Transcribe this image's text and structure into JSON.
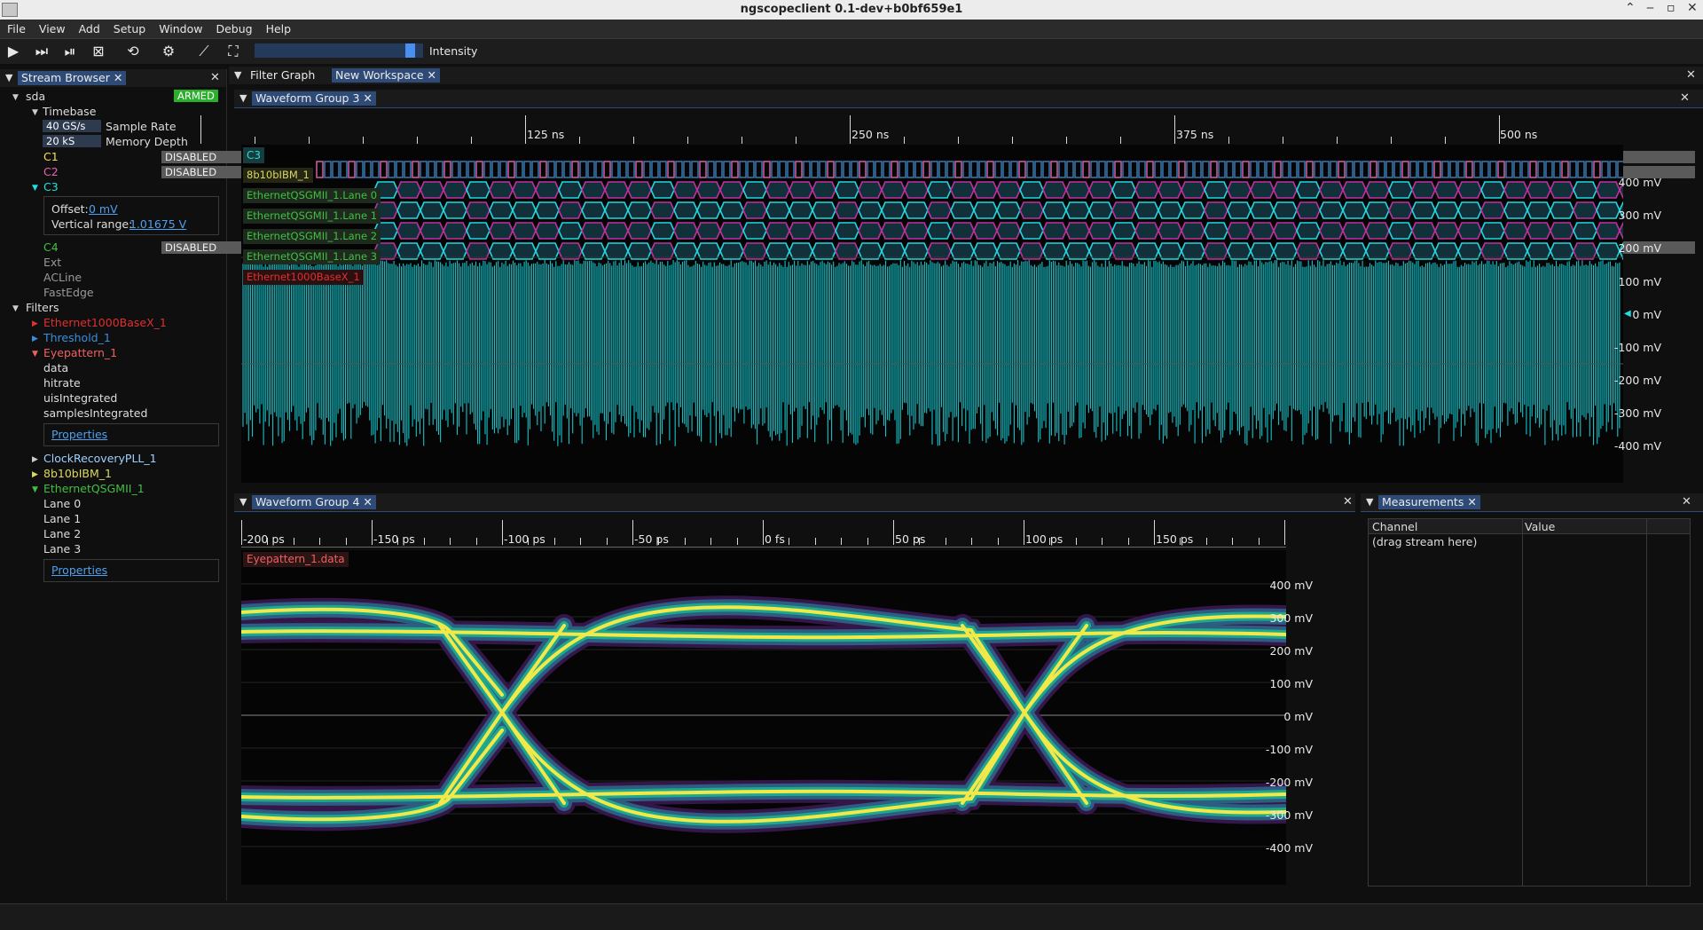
{
  "window": {
    "title": "ngscopeclient 0.1-dev+b0bf659e1"
  },
  "menu": [
    "File",
    "View",
    "Add",
    "Setup",
    "Window",
    "Debug",
    "Help"
  ],
  "toolbar": {
    "intensity_label": "Intensity",
    "intensity_level": 0.95
  },
  "stream_browser": {
    "tab": "Stream Browser",
    "instrument": "sda",
    "status": "ARMED",
    "timebase": {
      "label": "Timebase",
      "sample_rate": "40 GS/s",
      "sample_rate_label": "Sample Rate",
      "memory_depth": "20 kS",
      "memory_depth_label": "Memory Depth"
    },
    "channels": {
      "c1": {
        "name": "C1",
        "state": "DISABLED"
      },
      "c2": {
        "name": "C2",
        "state": "DISABLED"
      },
      "c3": {
        "name": "C3",
        "offset_label": "Offset:",
        "offset": "0 mV",
        "range_label": "Vertical range:",
        "range": "1.01675 V"
      },
      "c4": {
        "name": "C4",
        "state": "DISABLED"
      },
      "others": [
        "Ext",
        "ACLine",
        "FastEdge"
      ]
    },
    "filters_label": "Filters",
    "filters": {
      "eth1000": "Ethernet1000BaseX_1",
      "threshold": "Threshold_1",
      "eyepattern": "Eyepattern_1",
      "eye_streams": [
        "data",
        "hitrate",
        "uisIntegrated",
        "samplesIntegrated"
      ],
      "properties": "Properties",
      "cdr": "ClockRecoveryPLL_1",
      "ibm": "8b10bIBM_1",
      "qsgmii": "EthernetQSGMII_1",
      "lanes": [
        "Lane 0",
        "Lane 1",
        "Lane 2",
        "Lane 3"
      ],
      "properties2": "Properties"
    }
  },
  "workspace_tabs": [
    "Filter Graph",
    "New Workspace"
  ],
  "group3": {
    "tab": "Waveform Group 3",
    "time_ticks": [
      "125 ns",
      "250 ns",
      "375 ns",
      "500 ns"
    ],
    "channel": "C3",
    "protocols": [
      "8b10bIBM_1",
      "EthernetQSGMII_1.Lane 0",
      "EthernetQSGMII_1.Lane 1",
      "EthernetQSGMII_1.Lane 2",
      "EthernetQSGMII_1.Lane 3",
      "Ethernet1000BaseX_1"
    ],
    "volts": [
      "400 mV",
      "300 mV",
      "200 mV",
      "100 mV",
      "0 mV",
      "-100 mV",
      "-200 mV",
      "-300 mV",
      "-400 mV"
    ]
  },
  "group4": {
    "tab": "Waveform Group 4",
    "time_ticks": [
      "-200 ps",
      "-150 ps",
      "-100 ps",
      "-50 ps",
      "0 fs",
      "50 ps",
      "100 ps",
      "150 ps"
    ],
    "trace": "Eyepattern_1.data",
    "volts": [
      "400 mV",
      "300 mV",
      "200 mV",
      "100 mV",
      "0 mV",
      "-100 mV",
      "-200 mV",
      "-300 mV",
      "-400 mV"
    ]
  },
  "measurements": {
    "tab": "Measurements",
    "col_channel": "Channel",
    "col_value": "Value",
    "placeholder": "(drag stream here)"
  },
  "colors": {
    "c1": "#f0e050",
    "c2": "#f060b0",
    "c3": "#20e0e0",
    "c4": "#40c040",
    "eth": "#e03030",
    "threshold": "#3a8ee0",
    "eyepattern": "#f06060",
    "ibm": "#d8d860",
    "qsgmii": "#40c040",
    "armed": "#2ab02a",
    "tab_active": "#2e4b78"
  }
}
